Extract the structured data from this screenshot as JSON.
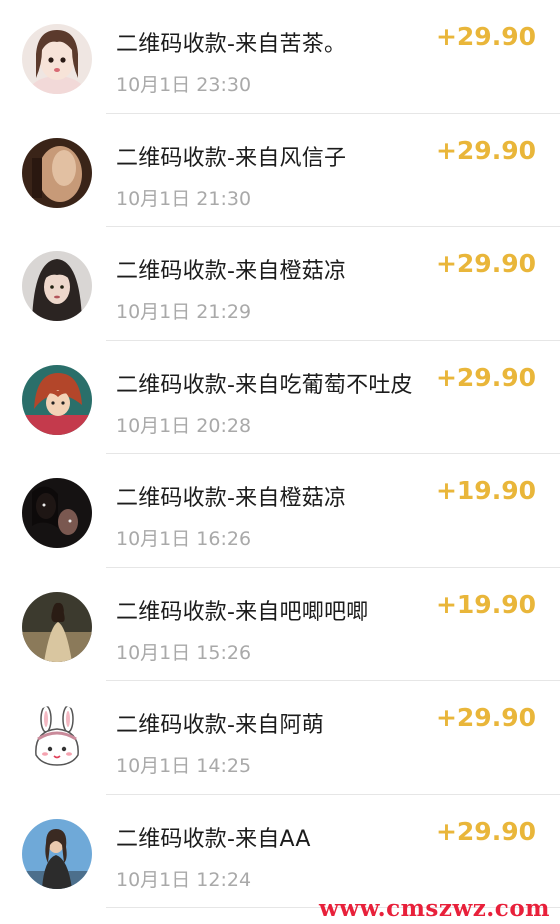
{
  "colors": {
    "amount": "#e9b63a",
    "title": "#1c1c1c",
    "time": "#a9a9a9",
    "watermark": "#e8203a"
  },
  "transactions": [
    {
      "title": "二维码收款-来自苦茶。",
      "time": "10月1日 23:30",
      "amount": "+29.90",
      "avatar_icon": "girl-portrait-avatar-icon"
    },
    {
      "title": "二维码收款-来自风信子",
      "time": "10月1日 21:30",
      "amount": "+29.90",
      "avatar_icon": "blurred-photo-avatar-icon"
    },
    {
      "title": "二维码收款-来自橙菇凉",
      "time": "10月1日 21:29",
      "amount": "+29.90",
      "avatar_icon": "woman-portrait-avatar-icon"
    },
    {
      "title": "二维码收款-来自吃葡萄不吐皮",
      "time": "10月1日 20:28",
      "amount": "+29.90",
      "avatar_icon": "anime-character-avatar-icon"
    },
    {
      "title": "二维码收款-来自橙菇凉",
      "time": "10月1日 16:26",
      "amount": "+19.90",
      "avatar_icon": "dark-photo-avatar-icon"
    },
    {
      "title": "二维码收款-来自吧唧吧唧",
      "time": "10月1日 15:26",
      "amount": "+19.90",
      "avatar_icon": "dress-photo-avatar-icon"
    },
    {
      "title": "二维码收款-来自阿萌",
      "time": "10月1日 14:25",
      "amount": "+29.90",
      "avatar_icon": "cartoon-bunny-avatar-icon"
    },
    {
      "title": "二维码收款-来自AA",
      "time": "10月1日 12:24",
      "amount": "+29.90",
      "avatar_icon": "seated-woman-avatar-icon"
    }
  ],
  "watermark": "www.cmszwz.com"
}
